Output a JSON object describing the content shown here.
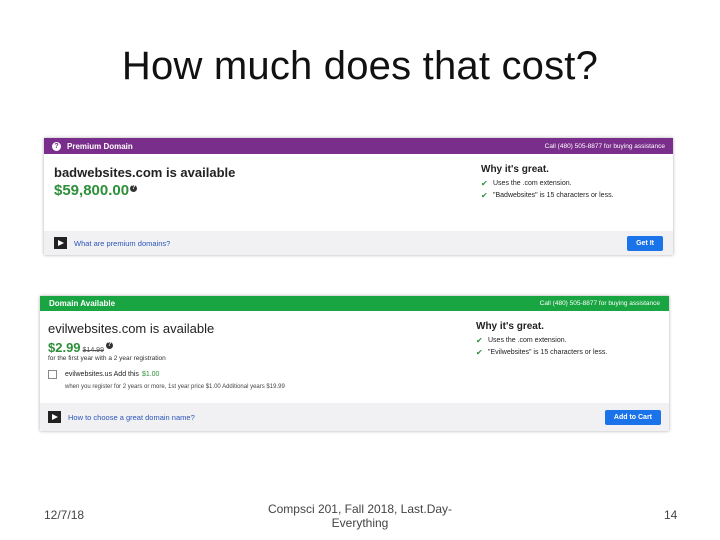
{
  "slide": {
    "title": "How much does that cost?",
    "footer": {
      "date": "12/7/18",
      "course": "Compsci 201, Fall 2018,  Last.Day-Everything",
      "page": "14"
    }
  },
  "premium": {
    "header_title": "Premium Domain",
    "header_icon": "question-icon",
    "header_phone": "Call (480) 505-8877 for buying assistance",
    "header_color": "#7a2e8b",
    "domain_text": "badwebsites.com is available",
    "price": "$59,800.00",
    "price_color": "#2e8f3a",
    "why_title": "Why it's great.",
    "why_items": [
      "Uses the .com extension.",
      "\"Badwebsites\" is 15 characters or less."
    ],
    "footer_link": "What are premium domains?",
    "button_label": "Get It"
  },
  "available": {
    "header_title": "Domain Available",
    "header_phone": "Call (480) 505-8877 for buying assistance",
    "header_color": "#19a541",
    "domain_text": "evilwebsites.com is available",
    "price": "$2.99",
    "old_price": "$14.99",
    "subtext": "for the first year with a 2 year registration",
    "addon_label": "evilwebsites.us Add this",
    "addon_price": "$1.00",
    "addon_note": "when you register for 2 years or more, 1st year price $1.00 Additional years $19.99",
    "why_title": "Why it's great.",
    "why_items": [
      "Uses the .com extension.",
      "\"Evilwebsites\" is 15 characters or less."
    ],
    "footer_link": "How to choose a great domain name?",
    "button_label": "Add to Cart"
  }
}
